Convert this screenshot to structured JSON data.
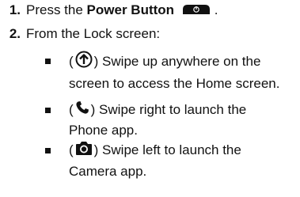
{
  "steps": [
    {
      "number": "1.",
      "text_prefix": "Press the ",
      "bold_text": "Power Button",
      "text_suffix": ".",
      "icon": "power-button-icon"
    },
    {
      "number": "2.",
      "text": "From the Lock screen:"
    }
  ],
  "substeps": [
    {
      "icon": "swipe-up-arrow-icon",
      "line1": ") Swipe up anywhere on the",
      "line2": "screen to access the Home screen."
    },
    {
      "icon": "phone-icon",
      "line1": ") Swipe right to launch the",
      "line2": "Phone app."
    },
    {
      "icon": "camera-icon",
      "line1": ") Swipe left to launch the",
      "line2": "Camera app."
    }
  ],
  "open_paren": "("
}
